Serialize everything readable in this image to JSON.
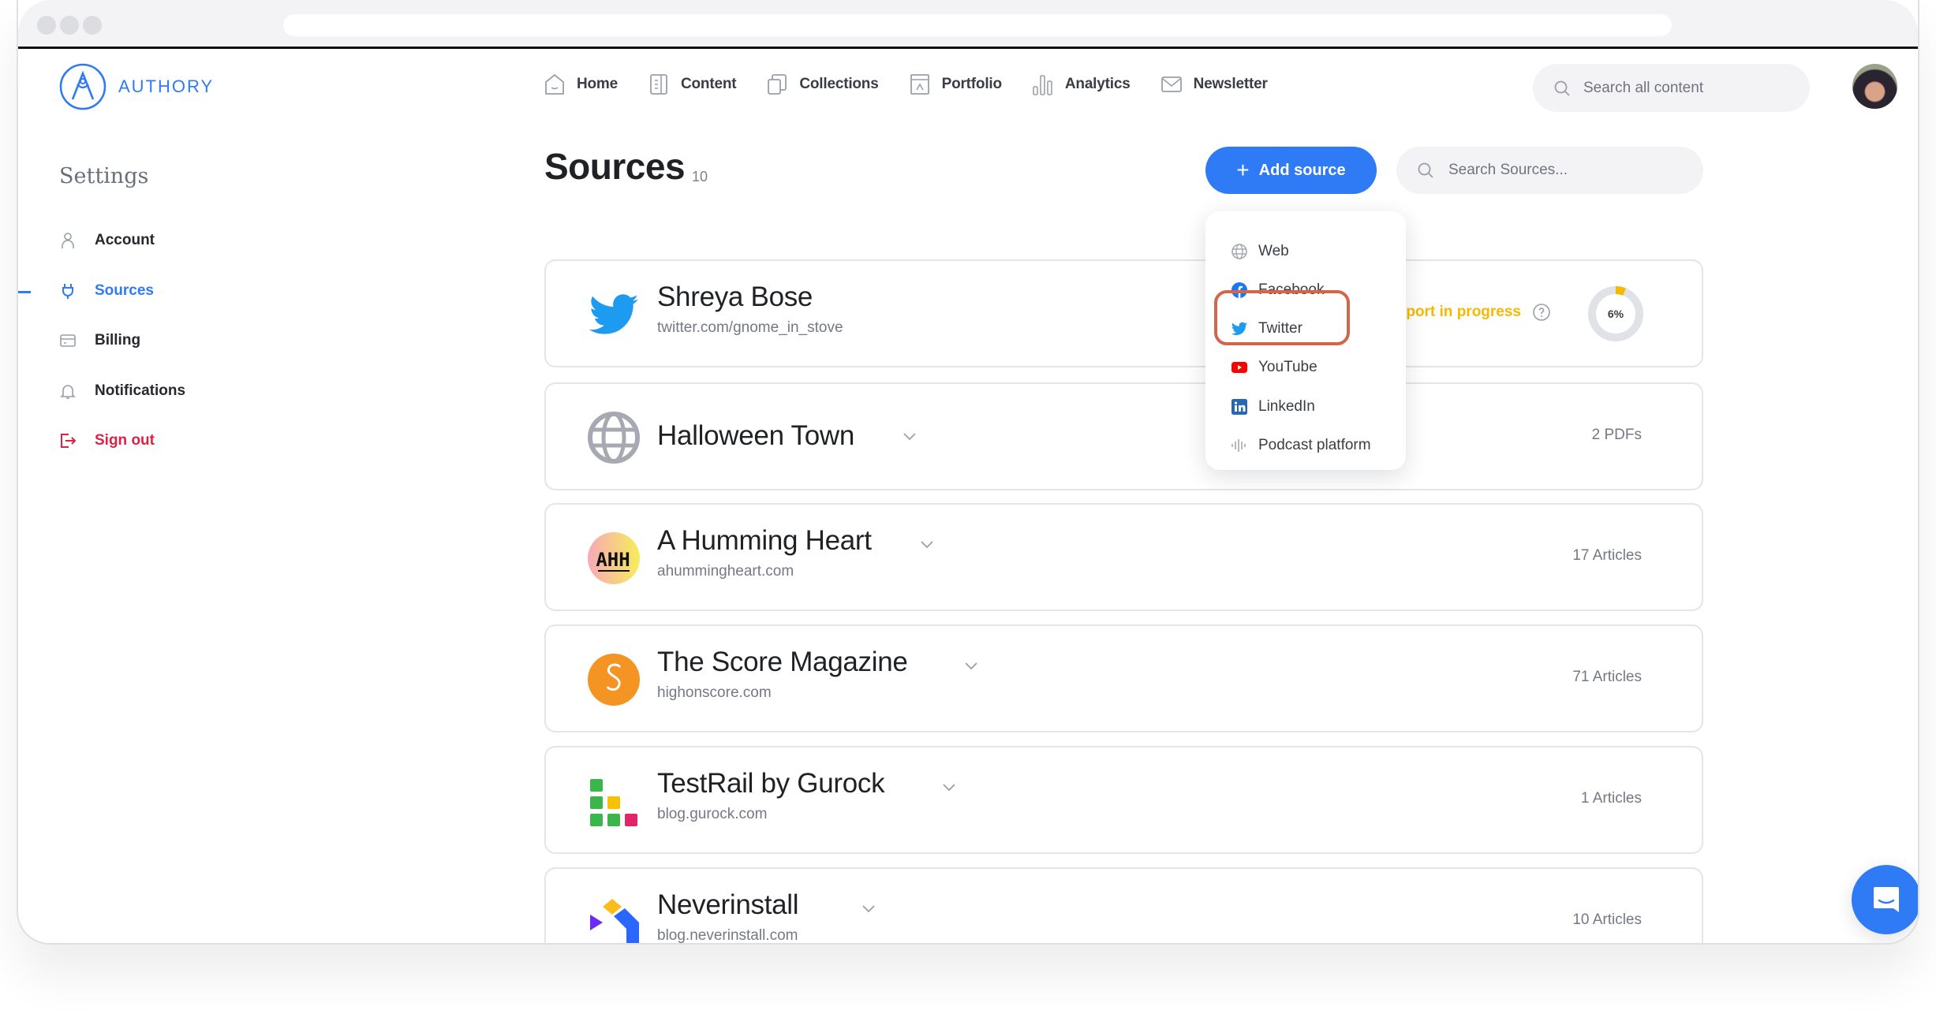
{
  "app": {
    "name": "AUTHORY",
    "brand_color": "#2f7bf5"
  },
  "nav": {
    "items": [
      {
        "label": "Home",
        "icon": "home-icon"
      },
      {
        "label": "Content",
        "icon": "content-icon"
      },
      {
        "label": "Collections",
        "icon": "collections-icon"
      },
      {
        "label": "Portfolio",
        "icon": "portfolio-icon"
      },
      {
        "label": "Analytics",
        "icon": "analytics-icon"
      },
      {
        "label": "Newsletter",
        "icon": "newsletter-icon"
      }
    ],
    "search_placeholder": "Search all content"
  },
  "sidebar": {
    "title": "Settings",
    "items": [
      {
        "label": "Account",
        "icon": "user-icon",
        "active": false
      },
      {
        "label": "Sources",
        "icon": "plug-icon",
        "active": true
      },
      {
        "label": "Billing",
        "icon": "card-icon",
        "active": false
      },
      {
        "label": "Notifications",
        "icon": "bell-icon",
        "active": false
      },
      {
        "label": "Sign out",
        "icon": "sign-out-icon",
        "active": false
      }
    ]
  },
  "main": {
    "title": "Sources",
    "count": "10",
    "add_button_label": "Add source",
    "search_placeholder": "Search Sources...",
    "add_menu": {
      "items": [
        {
          "label": "Web",
          "icon": "globe-icon"
        },
        {
          "label": "Facebook",
          "icon": "facebook-icon"
        },
        {
          "label": "Twitter",
          "icon": "twitter-icon",
          "highlighted": true
        },
        {
          "label": "YouTube",
          "icon": "youtube-icon"
        },
        {
          "label": "LinkedIn",
          "icon": "linkedin-icon"
        },
        {
          "label": "Podcast platform",
          "icon": "podcast-icon"
        }
      ]
    },
    "sources": [
      {
        "name": "Shreya Bose",
        "url": "twitter.com/gnome_in_stove",
        "icon": "twitter-icon",
        "status": "Import in progress",
        "progress_percent": 6,
        "progress_label": "6%"
      },
      {
        "name": "Halloween Town",
        "url": "",
        "icon": "globe-icon",
        "count": "2 PDFs"
      },
      {
        "name": "A Humming Heart",
        "url": "ahummingheart.com",
        "icon": "ahh-logo-icon",
        "count": "17 Articles"
      },
      {
        "name": "The Score Magazine",
        "url": "highonscore.com",
        "icon": "score-logo-icon",
        "count": "71 Articles"
      },
      {
        "name": "TestRail by Gurock",
        "url": "blog.gurock.com",
        "icon": "testrail-logo-icon",
        "count": "1 Articles"
      },
      {
        "name": "Neverinstall",
        "url": "blog.neverinstall.com",
        "icon": "neverinstall-logo-icon",
        "count": "10 Articles"
      }
    ]
  },
  "colors": {
    "status_in_progress": "#f6b800",
    "danger": "#df2145",
    "highlight": "#d2664a"
  }
}
